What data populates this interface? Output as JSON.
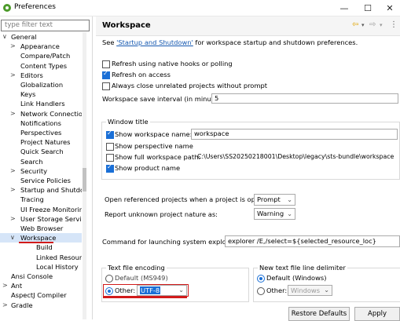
{
  "window": {
    "title": "Preferences",
    "min": "—",
    "max": "☐",
    "close": "✕"
  },
  "filter": {
    "placeholder": "type filter text"
  },
  "tree": [
    {
      "label": "General",
      "level": 0,
      "chev": "∨"
    },
    {
      "label": "Appearance",
      "level": 1,
      "chev": ">"
    },
    {
      "label": "Compare/Patch",
      "level": 1,
      "chev": ""
    },
    {
      "label": "Content Types",
      "level": 1,
      "chev": ""
    },
    {
      "label": "Editors",
      "level": 1,
      "chev": ">"
    },
    {
      "label": "Globalization",
      "level": 1,
      "chev": ""
    },
    {
      "label": "Keys",
      "level": 1,
      "chev": ""
    },
    {
      "label": "Link Handlers",
      "level": 1,
      "chev": ""
    },
    {
      "label": "Network Connection",
      "level": 1,
      "chev": ">"
    },
    {
      "label": "Notifications",
      "level": 1,
      "chev": ""
    },
    {
      "label": "Perspectives",
      "level": 1,
      "chev": ""
    },
    {
      "label": "Project Natures",
      "level": 1,
      "chev": ""
    },
    {
      "label": "Quick Search",
      "level": 1,
      "chev": ""
    },
    {
      "label": "Search",
      "level": 1,
      "chev": ""
    },
    {
      "label": "Security",
      "level": 1,
      "chev": ">"
    },
    {
      "label": "Service Policies",
      "level": 1,
      "chev": ""
    },
    {
      "label": "Startup and Shutdow",
      "level": 1,
      "chev": ">"
    },
    {
      "label": "Tracing",
      "level": 1,
      "chev": ""
    },
    {
      "label": "UI Freeze Monitoring",
      "level": 1,
      "chev": ""
    },
    {
      "label": "User Storage Service",
      "level": 1,
      "chev": ">"
    },
    {
      "label": "Web Browser",
      "level": 1,
      "chev": ""
    },
    {
      "label": "Workspace",
      "level": 1,
      "chev": "∨",
      "selected": true
    },
    {
      "label": "Build",
      "level": 2,
      "chev": ""
    },
    {
      "label": "Linked Resources",
      "level": 2,
      "chev": ""
    },
    {
      "label": "Local History",
      "level": 2,
      "chev": ""
    },
    {
      "label": "Ansi Console",
      "level": 0,
      "chev": ""
    },
    {
      "label": "Ant",
      "level": 0,
      "chev": ">"
    },
    {
      "label": "AspectJ Compiler",
      "level": 0,
      "chev": ""
    },
    {
      "label": "Gradle",
      "level": 0,
      "chev": ">"
    }
  ],
  "page": {
    "title": "Workspace",
    "nav_back": "⇦",
    "nav_back_menu": "▾",
    "nav_forward": "⇨",
    "nav_forward_menu": "▾",
    "nav_more": "⋮",
    "intro_prefix": "See ",
    "intro_link": "'Startup and Shutdown'",
    "intro_suffix": " for workspace startup and shutdown preferences.",
    "cb_refresh_native": "Refresh using native hooks or polling",
    "cb_refresh_access": "Refresh on access",
    "cb_close_unrelated": "Always close unrelated projects without prompt",
    "save_interval_label": "Workspace save interval (in minutes):",
    "save_interval_value": "5",
    "window_title_group": "Window title",
    "show_ws_name_label": "Show workspace name:",
    "show_ws_name_value": "workspace",
    "show_perspective": "Show perspective name",
    "show_full_path_label": "Show full workspace path:",
    "show_full_path_value": "C:\\Users\\SS20250218001\\Desktop\\legacy\\sts-bundle\\workspace",
    "show_product": "Show product name",
    "open_ref_label": "Open referenced projects when a project is opened:",
    "open_ref_value": "Prompt",
    "unknown_nature_label": "Report unknown project nature as:",
    "unknown_nature_value": "Warning",
    "cmd_label": "Command for launching system explorer:",
    "cmd_value": "explorer /E,/select=${selected_resource_loc}",
    "encoding_group": "Text file encoding",
    "enc_default": "Default (MS949)",
    "enc_other": "Other:",
    "enc_other_value": "UTF-8",
    "delim_group": "New text file line delimiter",
    "delim_default": "Default (Windows)",
    "delim_other": "Other:",
    "delim_other_value": "Windows",
    "restore_defaults": "Restore Defaults",
    "apply": "Apply"
  }
}
